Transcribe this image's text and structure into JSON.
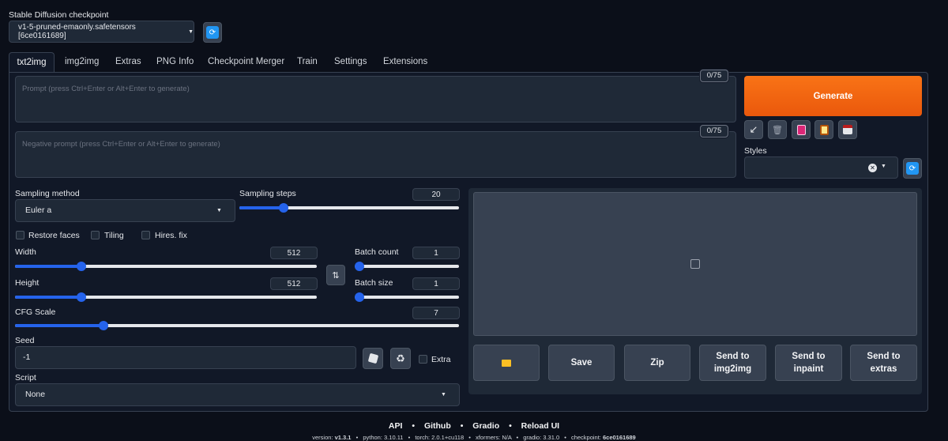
{
  "checkpoint": {
    "label": "Stable Diffusion checkpoint",
    "value": "v1-5-pruned-emaonly.safetensors [6ce0161689]"
  },
  "tabs": [
    "txt2img",
    "img2img",
    "Extras",
    "PNG Info",
    "Checkpoint Merger",
    "Train",
    "Settings",
    "Extensions"
  ],
  "prompt": {
    "placeholder": "Prompt (press Ctrl+Enter or Alt+Enter to generate)",
    "counter": "0/75"
  },
  "negative_prompt": {
    "placeholder": "Negative prompt (press Ctrl+Enter or Alt+Enter to generate)",
    "counter": "0/75"
  },
  "generate_label": "Generate",
  "styles_label": "Styles",
  "sampling": {
    "method_label": "Sampling method",
    "method_value": "Euler a",
    "steps_label": "Sampling steps",
    "steps_value": "20",
    "steps_fraction": 0.2
  },
  "checkboxes": {
    "restore_faces": "Restore faces",
    "tiling": "Tiling",
    "hires_fix": "Hires. fix"
  },
  "width": {
    "label": "Width",
    "value": "512",
    "fraction": 0.22
  },
  "height": {
    "label": "Height",
    "value": "512",
    "fraction": 0.22
  },
  "batch_count": {
    "label": "Batch count",
    "value": "1",
    "fraction": 0.0
  },
  "batch_size": {
    "label": "Batch size",
    "value": "1",
    "fraction": 0.0
  },
  "cfg": {
    "label": "CFG Scale",
    "value": "7",
    "fraction": 0.2
  },
  "seed": {
    "label": "Seed",
    "value": "-1",
    "extra_label": "Extra"
  },
  "script": {
    "label": "Script",
    "value": "None"
  },
  "output_buttons": {
    "save": "Save",
    "zip": "Zip",
    "send_img2img": "Send to img2img",
    "send_inpaint": "Send to inpaint",
    "send_extras": "Send to extras"
  },
  "footer": {
    "links": [
      "API",
      "Github",
      "Gradio",
      "Reload UI"
    ],
    "version_label": "version:",
    "version": "v1.3.1",
    "python_label": "python:",
    "python": "3.10.11",
    "torch_label": "torch:",
    "torch": "2.0.1+cu118",
    "xformers_label": "xformers:",
    "xformers": "N/A",
    "gradio_label": "gradio:",
    "gradio": "3.31.0",
    "checkpoint_label": "checkpoint:",
    "checkpoint": "6ce0161689"
  },
  "colors": {
    "background": "#0b0f19",
    "accent": "#f97316",
    "slider": "#2563eb",
    "refresh": "#2196f3"
  }
}
